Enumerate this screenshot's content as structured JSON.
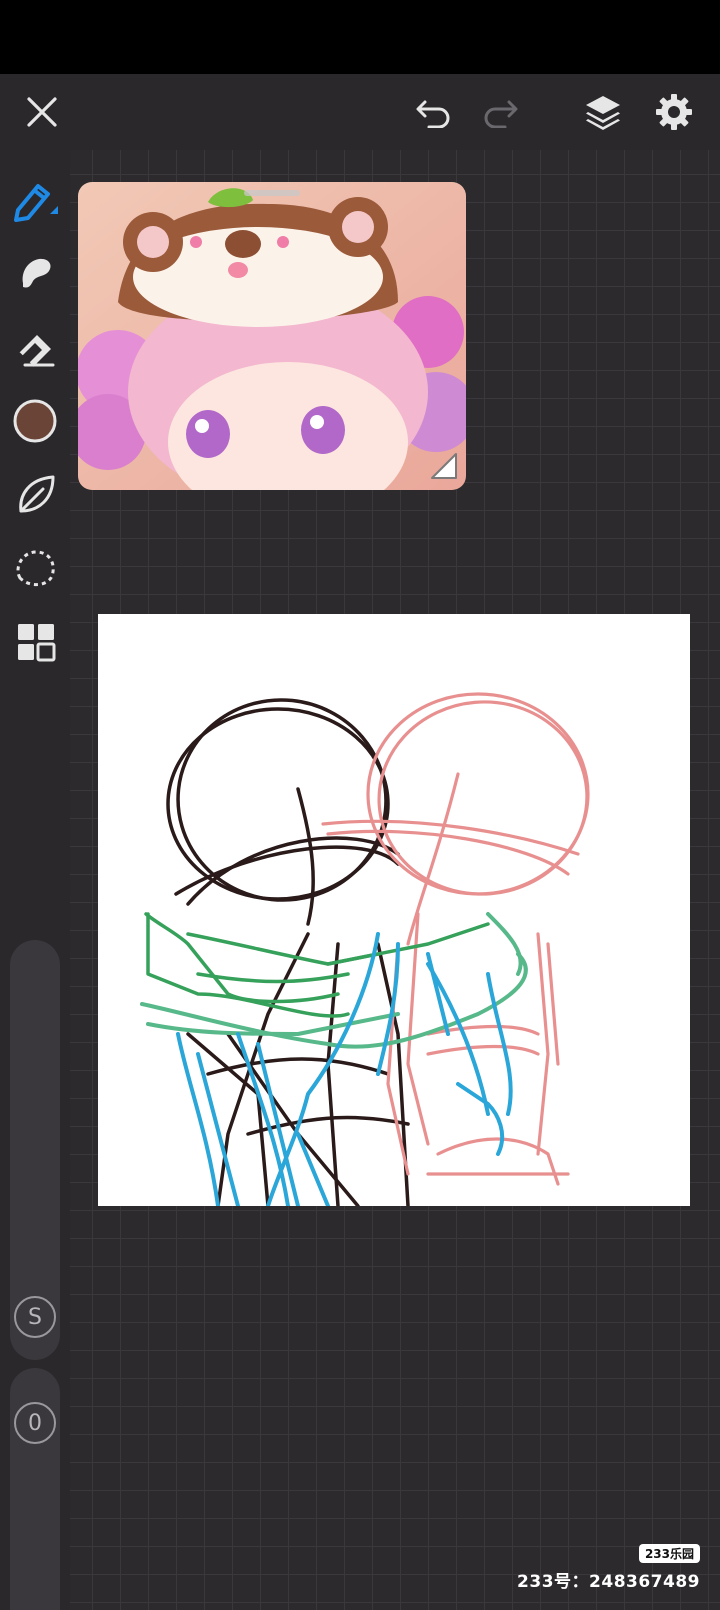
{
  "app": {
    "accent_color": "#1e8ae6",
    "background_color": "#2c2a2d",
    "current_brush_color": "#6b4438"
  },
  "top_bar": {
    "close_icon": "close-icon",
    "undo_icon": "undo-icon",
    "redo_icon": "redo-icon",
    "layers_icon": "layers-icon",
    "settings_icon": "gear-icon"
  },
  "tools": [
    {
      "name": "pencil",
      "icon": "pencil-icon",
      "selected": true
    },
    {
      "name": "smudge",
      "icon": "smudge-icon",
      "selected": false
    },
    {
      "name": "eraser",
      "icon": "eraser-icon",
      "selected": false
    },
    {
      "name": "color",
      "icon": "color-swatch",
      "selected": false
    },
    {
      "name": "brush-library",
      "icon": "leaf-icon",
      "selected": false
    },
    {
      "name": "lasso",
      "icon": "lasso-icon",
      "selected": false
    },
    {
      "name": "more",
      "icon": "grid-icon",
      "selected": false
    }
  ],
  "sliders": {
    "size_label": "S",
    "opacity_label": "0"
  },
  "reference": {
    "description": "reference image of chibi character wearing bear hat"
  },
  "watermark": {
    "logo": "233乐园",
    "text": "233号：248367489"
  }
}
